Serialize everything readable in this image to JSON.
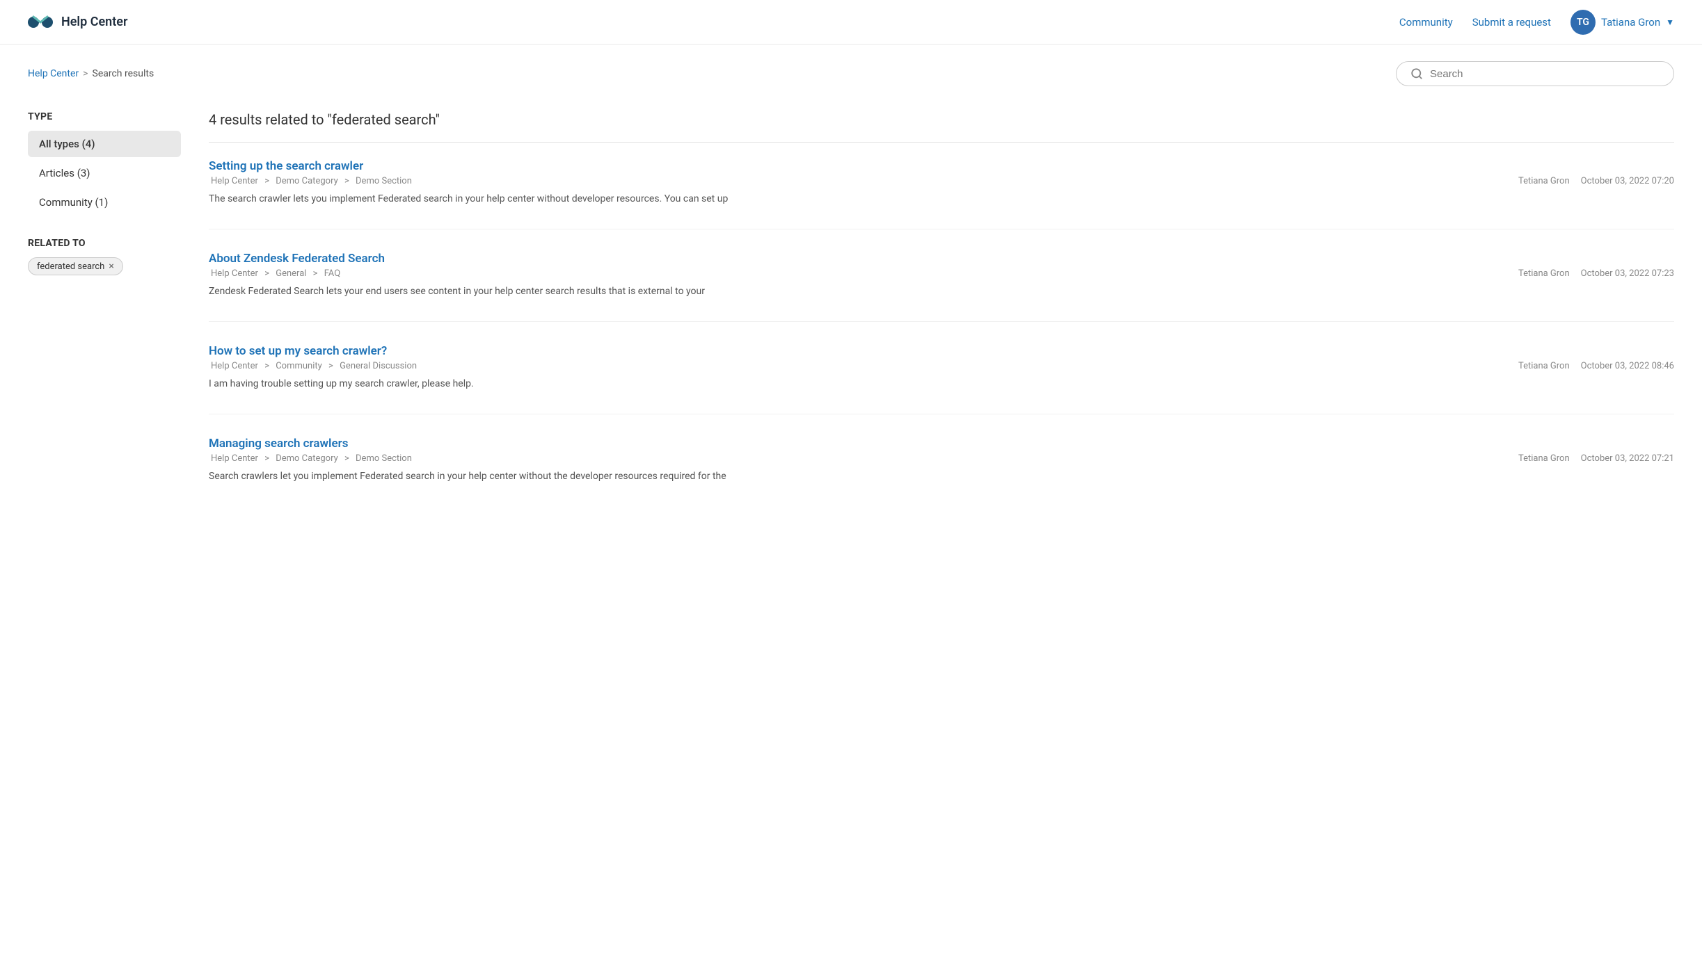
{
  "header": {
    "logo_text": "Help Center",
    "nav": {
      "community": "Community",
      "submit_request": "Submit a request",
      "user_name": "Tatiana Gron",
      "user_initials": "TG"
    }
  },
  "breadcrumb": {
    "home": "Help Center",
    "separator": ">",
    "current": "Search results"
  },
  "search": {
    "placeholder": "Search"
  },
  "sidebar": {
    "type_label": "Type",
    "filters": [
      {
        "label": "All types (4)",
        "active": true
      },
      {
        "label": "Articles (3)",
        "active": false
      },
      {
        "label": "Community (1)",
        "active": false
      }
    ],
    "related_label": "Related to",
    "tag": "federated search"
  },
  "results": {
    "heading": "4 results related to \"federated search\"",
    "items": [
      {
        "title": "Setting up the search crawler",
        "breadcrumb": [
          "Help Center",
          "Demo Category",
          "Demo Section"
        ],
        "author": "Tetiana Gron",
        "date": "October 03, 2022 07:20",
        "excerpt": "The search crawler lets you implement Federated search in your help center without developer resources. You can set up"
      },
      {
        "title": "About Zendesk Federated Search",
        "breadcrumb": [
          "Help Center",
          "General",
          "FAQ"
        ],
        "author": "Tetiana Gron",
        "date": "October 03, 2022 07:23",
        "excerpt": "Zendesk Federated Search lets your end users see content in your help center search results that is external to your"
      },
      {
        "title": "How to set up my search crawler?",
        "breadcrumb": [
          "Help Center",
          "Community",
          "General Discussion"
        ],
        "author": "Tetiana Gron",
        "date": "October 03, 2022 08:46",
        "excerpt": "I am having trouble setting up my search crawler, please help."
      },
      {
        "title": "Managing search crawlers",
        "breadcrumb": [
          "Help Center",
          "Demo Category",
          "Demo Section"
        ],
        "author": "Tetiana Gron",
        "date": "October 03, 2022 07:21",
        "excerpt": "Search crawlers let you implement Federated search in your help center without the developer resources required for the"
      }
    ]
  }
}
